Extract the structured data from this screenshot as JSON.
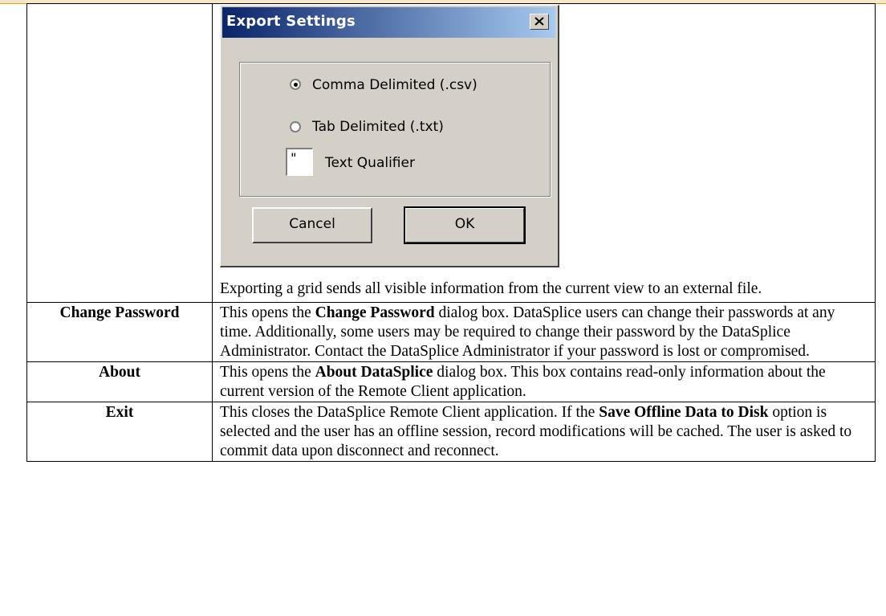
{
  "dialog": {
    "title": "Export Settings",
    "options": [
      {
        "label": "Comma Delimited (.csv)",
        "selected": true
      },
      {
        "label": "Tab Delimited (.txt)",
        "selected": false
      }
    ],
    "qualifier": {
      "value": "\"",
      "label": "Text Qualifier"
    },
    "cancel_label": "Cancel",
    "ok_label": "OK",
    "icons": {
      "close": "close-icon"
    }
  },
  "rows": [
    {
      "label": "",
      "text": "Exporting a grid sends all visible information from the current view to an external file."
    },
    {
      "label": "Change Password",
      "pre": "This opens the ",
      "bold": "Change Password",
      "post": " dialog box. DataSplice users can change their passwords at any time. Additionally, some users may be required to change their password by the DataSplice Administrator. Contact the DataSplice Administrator if your password is lost or compromised."
    },
    {
      "label": "About",
      "pre": "This opens the ",
      "bold": "About DataSplice",
      "post": " dialog box. This box contains read-only information about the current version of the Remote Client application."
    },
    {
      "label": "Exit",
      "pre": "This closes the DataSplice Remote Client application. If the ",
      "bold": "Save Offline Data to Disk",
      "post": " option is selected and the user has an offline session, record modifications will be cached. The user is asked to commit data upon disconnect and reconnect."
    }
  ]
}
